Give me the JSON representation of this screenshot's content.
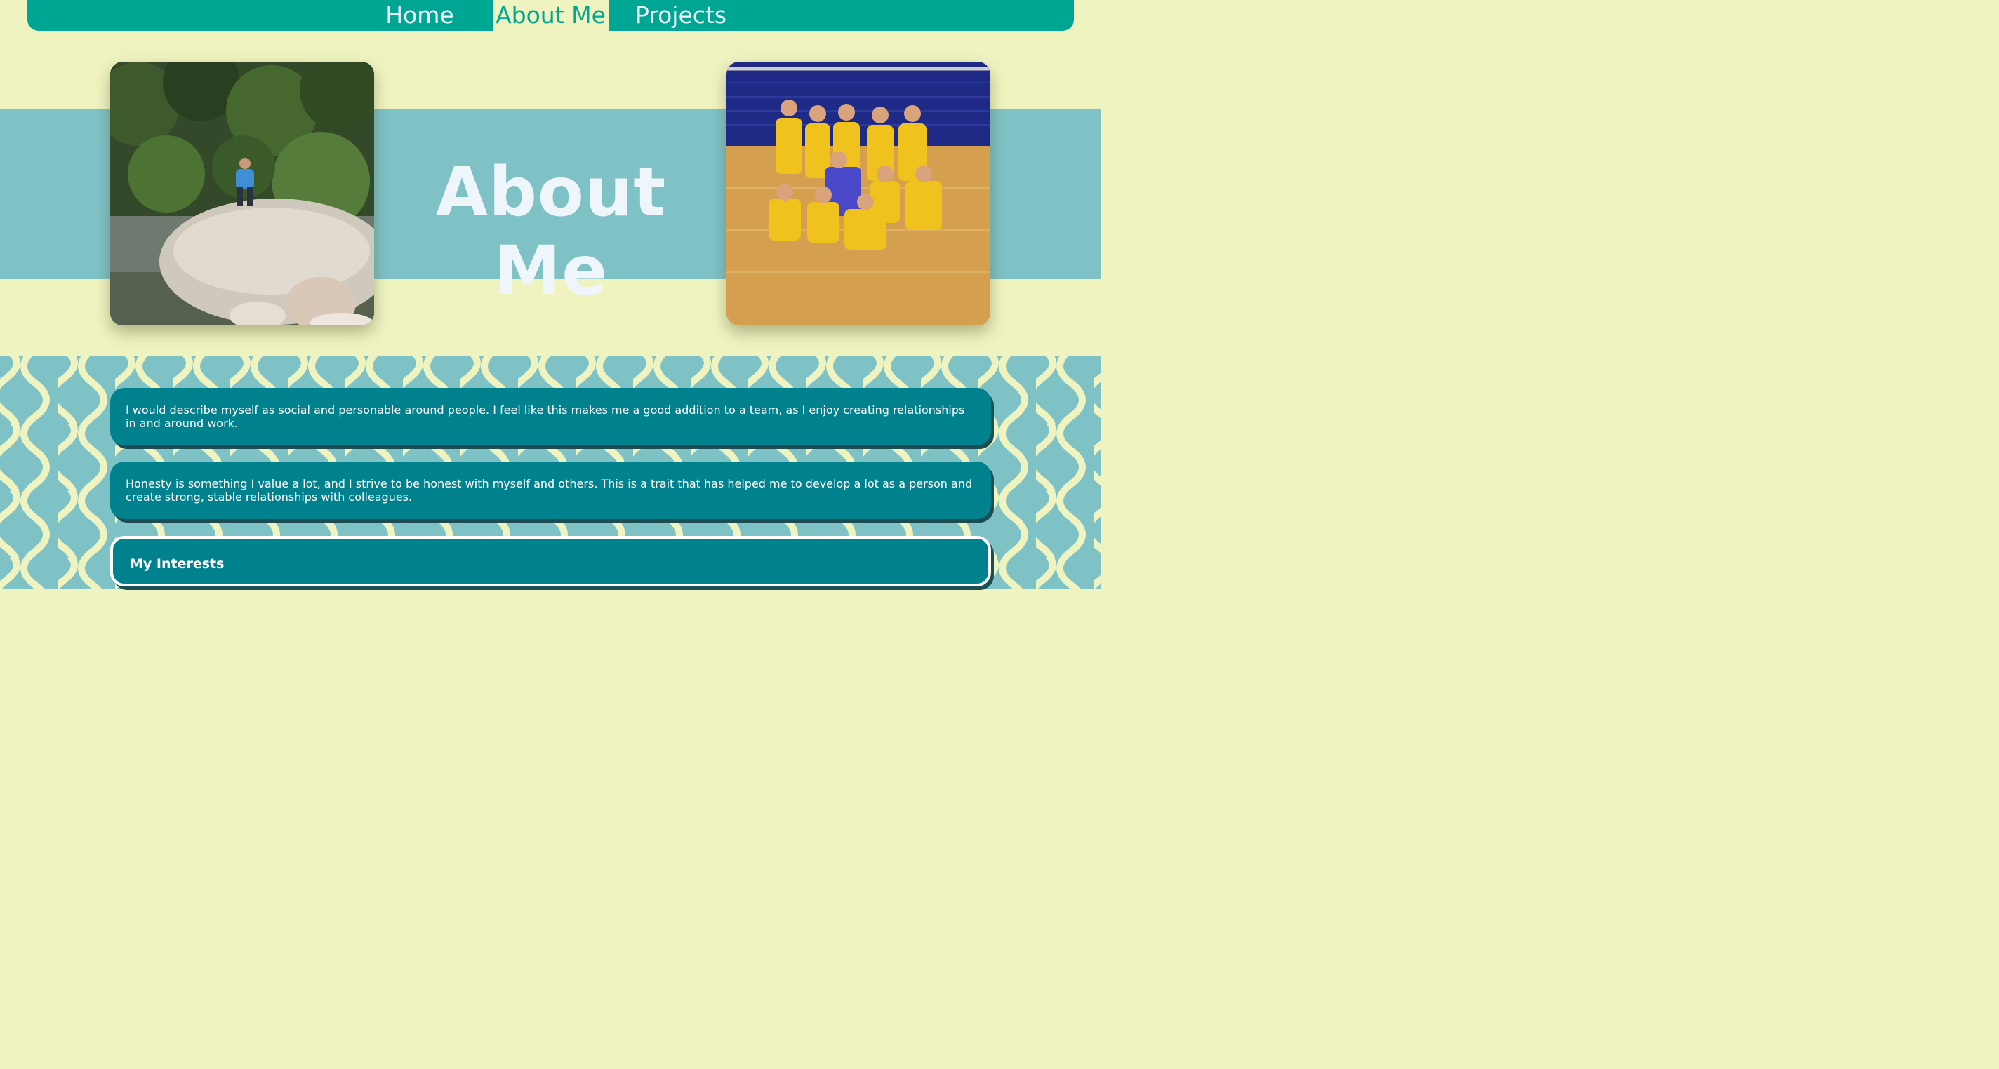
{
  "nav": {
    "tabs": [
      {
        "label": "Home",
        "active": false
      },
      {
        "label": "About Me",
        "active": true
      },
      {
        "label": "Projects",
        "active": false
      }
    ]
  },
  "hero": {
    "title": "About Me"
  },
  "cards": [
    {
      "text": "I would describe myself as social and personable around people. I feel like this makes me a good addition to a team, as I enjoy creating relationships in and around work."
    },
    {
      "text": "Honesty is something I value a lot, and I strive to be honest with myself and others. This is a trait that has helped me to develop a lot as a person and create strong, stable relationships with colleagues."
    }
  ],
  "interests": {
    "heading": "My Interests"
  },
  "colors": {
    "nav": "#00a694",
    "background": "#eff3c0",
    "band": "#7fc2c6",
    "card": "#00818e",
    "title": "#eef6fc"
  }
}
